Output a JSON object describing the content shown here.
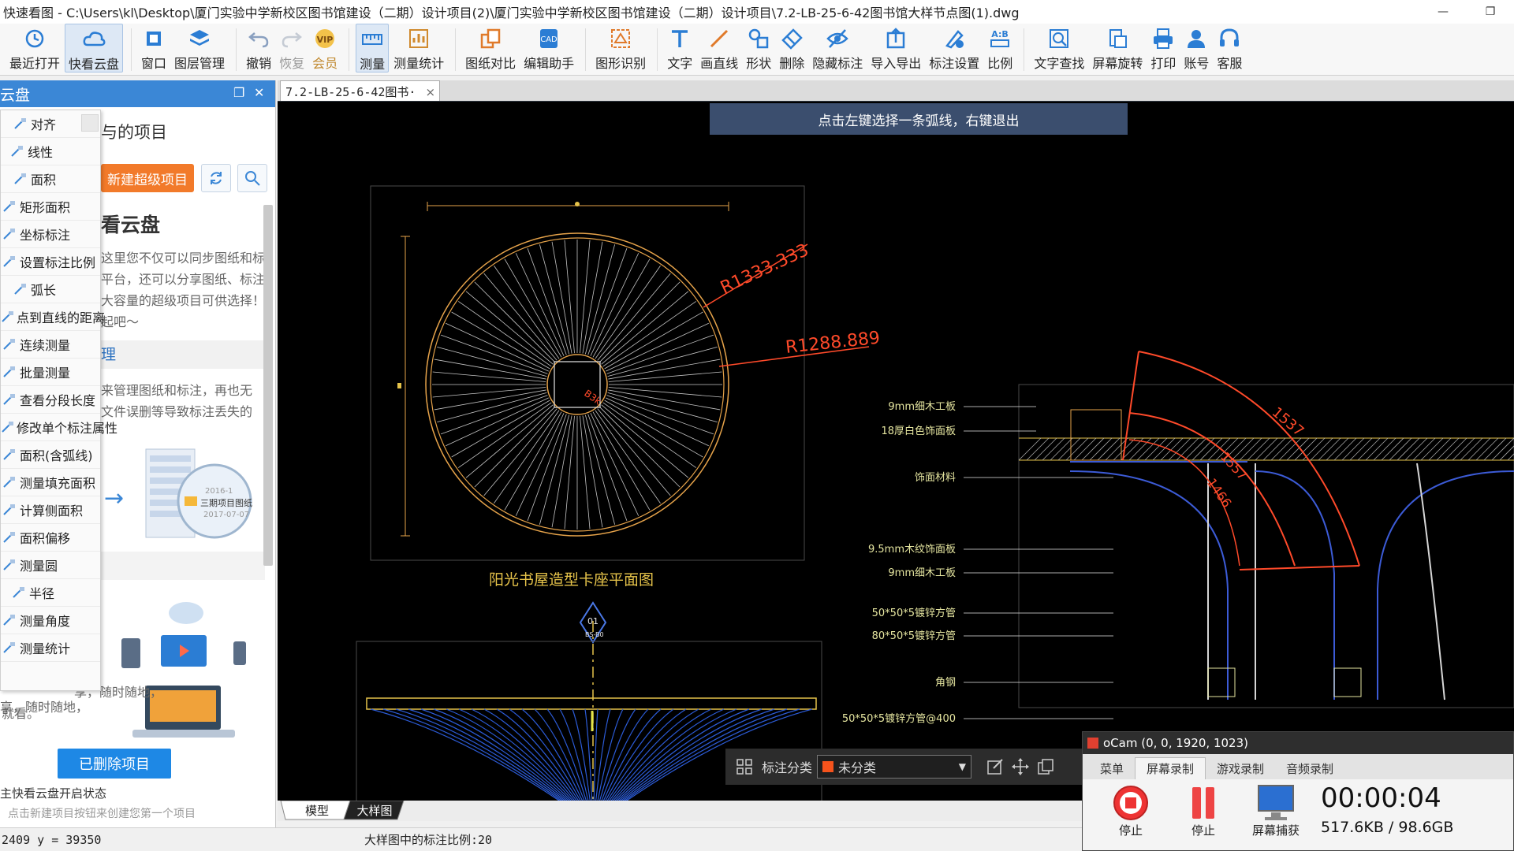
{
  "window": {
    "title": "快速看图 - C:\\Users\\kl\\Desktop\\厦门实验中学新校区图书馆建设（二期）设计项目(2)\\厦门实验中学新校区图书馆建设（二期）设计项目\\7.2-LB-25-6-42图书馆大样节点图(1).dwg",
    "minimize": "—",
    "restore": "❐"
  },
  "toolbar": [
    {
      "label": "最近打开",
      "icon": "history-icon",
      "active": false
    },
    {
      "label": "快看云盘",
      "icon": "cloud-icon",
      "active": true
    },
    {
      "label": "窗口",
      "icon": "window-icon",
      "active": false
    },
    {
      "label": "图层管理",
      "icon": "layers-icon",
      "active": false
    },
    {
      "label": "撤销",
      "icon": "undo-icon",
      "active": false
    },
    {
      "label": "恢复",
      "icon": "redo-icon",
      "active": false
    },
    {
      "label": "会员",
      "icon": "vip-icon",
      "active": false
    },
    {
      "label": "测量",
      "icon": "measure-icon",
      "active": true
    },
    {
      "label": "测量统计",
      "icon": "measure-stats-icon",
      "active": false
    },
    {
      "label": "图纸对比",
      "icon": "compare-icon",
      "active": false
    },
    {
      "label": "编辑助手",
      "icon": "edit-assistant-icon",
      "active": false
    },
    {
      "label": "图形识别",
      "icon": "shape-recognition-icon",
      "active": false
    },
    {
      "label": "文字",
      "icon": "text-icon",
      "active": false
    },
    {
      "label": "画直线",
      "icon": "line-icon",
      "active": false
    },
    {
      "label": "形状",
      "icon": "shape-icon",
      "active": false
    },
    {
      "label": "删除",
      "icon": "eraser-icon",
      "active": false
    },
    {
      "label": "隐藏标注",
      "icon": "hide-icon",
      "active": false
    },
    {
      "label": "导入导出",
      "icon": "import-export-icon",
      "active": false
    },
    {
      "label": "标注设置",
      "icon": "annotation-settings-icon",
      "active": false
    },
    {
      "label": "比例",
      "icon": "scale-icon",
      "active": false
    },
    {
      "label": "文字查找",
      "icon": "text-search-icon",
      "active": false
    },
    {
      "label": "屏幕旋转",
      "icon": "rotate-icon",
      "active": false
    },
    {
      "label": "打印",
      "icon": "print-icon",
      "active": false
    },
    {
      "label": "账号",
      "icon": "account-icon",
      "active": false
    },
    {
      "label": "客服",
      "icon": "headset-icon",
      "active": false
    }
  ],
  "left_panel": {
    "header": "云盘",
    "project_title": "与的项目",
    "new_button": "新建超级项目",
    "body_title": "看云盘",
    "para1": [
      "这里您不仅可以同步图纸和标",
      "平台，还可以分享图纸、标注",
      "大容量的超级项目可供选择！",
      "起吧～"
    ],
    "section_title": "理",
    "para2": [
      "来管理图纸和标注，再也无",
      "文件误删等导致标注丢失的"
    ],
    "illus_date1": "2016-1",
    "illus_label": "三期项目图纸",
    "illus_date2": "2017-07-07",
    "para3": [
      "享，随时随地，",
      "就看。"
    ],
    "deleted_button": "已删除项目",
    "footer1": "主快看云盘开启状态",
    "footer2": "点击新建项目按钮来创建您第一个项目"
  },
  "measure_menu": [
    "对齐",
    "线性",
    "面积",
    "矩形面积",
    "坐标标注",
    "设置标注比例",
    "弧长",
    "点到直线的距离",
    "连续测量",
    "批量测量",
    "查看分段长度",
    "修改单个标注属性",
    "面积(含弧线)",
    "测量填充面积",
    "计算侧面积",
    "面积偏移",
    "测量圆",
    "半径",
    "测量角度",
    "测量统计"
  ],
  "doc_tab": {
    "label": "7.2-LB-25-6-42图书·",
    "close": "×"
  },
  "hint": "点击左键选择一条弧线，右键退出",
  "drawing": {
    "radius_outer": "R1333.333",
    "radius_inner": "R1288.889",
    "plan_caption": "阳光书屋造型卡座平面图",
    "section_marker_top": "01",
    "section_marker_bottom": "BS-B0",
    "arc1": "1537",
    "arc2": "1557",
    "arc3": "1466",
    "detail_labels": [
      "9mm细木工板",
      "18厚白色饰面板",
      "饰面材料",
      "9.5mm木纹饰面板",
      "9mm细木工板",
      "50*50*5镀锌方管",
      "80*50*5镀锌方管",
      "角钢",
      "50*50*5镀锌方管@400"
    ],
    "center_label": "B3k"
  },
  "annotation_bar": {
    "label": "标注分类",
    "value": "未分类",
    "swatch_color": "#f5531c"
  },
  "sheet_tabs": [
    "模型",
    "大样图"
  ],
  "status": {
    "coords": "2409 y = 39350",
    "scale_text": "大样图中的标注比例:20"
  },
  "ocam": {
    "title": "oCam (0, 0, 1920, 1023)",
    "tabs": [
      "菜单",
      "屏幕录制",
      "游戏录制",
      "音频录制"
    ],
    "stop1": "停止",
    "stop2": "停止",
    "capture": "屏幕捕获",
    "time": "00:00:04",
    "size": "517.6KB / 98.6GB"
  },
  "colors": {
    "accent": "#3b87d6",
    "cad_line": "#e6a34a",
    "cad_red": "#ff4a2a",
    "cad_blue": "#2c5bd6"
  }
}
